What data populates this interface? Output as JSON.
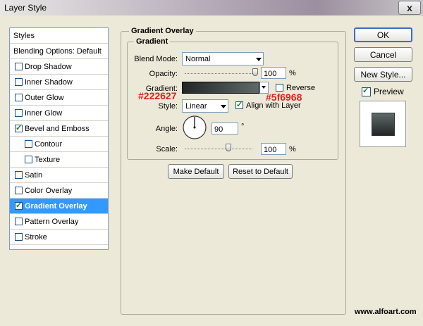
{
  "window": {
    "title": "Layer Style",
    "close_symbol": "x"
  },
  "sidebar": {
    "items": [
      {
        "label": "Styles",
        "checkbox": false,
        "checked": false,
        "selected": false,
        "indent": false
      },
      {
        "label": "Blending Options: Default",
        "checkbox": false,
        "checked": false,
        "selected": false,
        "indent": false
      },
      {
        "label": "Drop Shadow",
        "checkbox": true,
        "checked": false,
        "selected": false,
        "indent": false
      },
      {
        "label": "Inner Shadow",
        "checkbox": true,
        "checked": false,
        "selected": false,
        "indent": false
      },
      {
        "label": "Outer Glow",
        "checkbox": true,
        "checked": false,
        "selected": false,
        "indent": false
      },
      {
        "label": "Inner Glow",
        "checkbox": true,
        "checked": false,
        "selected": false,
        "indent": false
      },
      {
        "label": "Bevel and Emboss",
        "checkbox": true,
        "checked": true,
        "selected": false,
        "indent": false
      },
      {
        "label": "Contour",
        "checkbox": true,
        "checked": false,
        "selected": false,
        "indent": true
      },
      {
        "label": "Texture",
        "checkbox": true,
        "checked": false,
        "selected": false,
        "indent": true
      },
      {
        "label": "Satin",
        "checkbox": true,
        "checked": false,
        "selected": false,
        "indent": false
      },
      {
        "label": "Color Overlay",
        "checkbox": true,
        "checked": false,
        "selected": false,
        "indent": false
      },
      {
        "label": "Gradient Overlay",
        "checkbox": true,
        "checked": true,
        "selected": true,
        "indent": false
      },
      {
        "label": "Pattern Overlay",
        "checkbox": true,
        "checked": false,
        "selected": false,
        "indent": false
      },
      {
        "label": "Stroke",
        "checkbox": true,
        "checked": false,
        "selected": false,
        "indent": false
      }
    ]
  },
  "panel": {
    "outer_title": "Gradient Overlay",
    "inner_title": "Gradient",
    "blend_mode": {
      "label": "Blend Mode:",
      "value": "Normal"
    },
    "opacity": {
      "label": "Opacity:",
      "value": "100",
      "unit": "%",
      "level": 1.0
    },
    "gradient": {
      "label": "Gradient:",
      "start_color": "#222627",
      "end_color": "#5f6968",
      "reverse_label": "Reverse",
      "reverse_checked": false
    },
    "style": {
      "label": "Style:",
      "value": "Linear",
      "align_label": "Align with Layer",
      "align_checked": true
    },
    "angle": {
      "label": "Angle:",
      "value": "90",
      "unit": "°"
    },
    "scale": {
      "label": "Scale:",
      "value": "100",
      "unit": "%",
      "level": 0.66
    },
    "make_default": "Make Default",
    "reset_default": "Reset to Default"
  },
  "annotations": {
    "start": "#222627",
    "end": "#5f6968"
  },
  "right": {
    "ok": "OK",
    "cancel": "Cancel",
    "new_style": "New Style...",
    "preview_label": "Preview",
    "preview_checked": true
  },
  "watermark": "www.alfoart.com",
  "colors": {
    "selection": "#3399ff",
    "annotation": "#e02020",
    "dialog_bg": "#ece9d8"
  }
}
